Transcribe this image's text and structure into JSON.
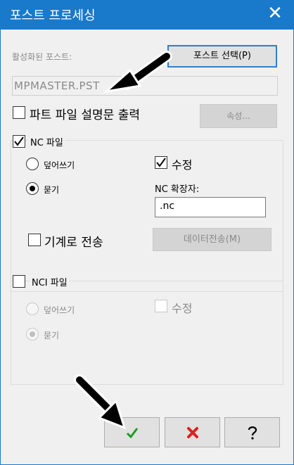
{
  "window": {
    "title": "포스트 프로세싱",
    "close_label": "✕"
  },
  "post": {
    "active_label": "활성화된 포스트:",
    "select_button": "포스트 선택(P)",
    "path_value": "MPMASTER.PST",
    "print_desc_label": "파트 파일 설명문 출력",
    "properties_button": "속성..."
  },
  "nc": {
    "group_title": "NC 파일",
    "overwrite_label": "덮어쓰기",
    "ask_label": "묻기",
    "edit_label": "수정",
    "ext_label": "NC 확장자:",
    "ext_value": ".nc",
    "send_label": "기계로 전송",
    "transfer_button": "데이터전송(M)"
  },
  "nci": {
    "group_title": "NCI 파일",
    "overwrite_label": "덮어쓰기",
    "ask_label": "묻기",
    "edit_label": "수정"
  },
  "footer": {
    "ok_icon": "checkmark-icon",
    "cancel_icon": "red-x-icon",
    "help_icon": "question-icon"
  },
  "colors": {
    "titlebar": "#1979ca",
    "ok": "#1a9d1a",
    "cancel": "#e0201c"
  }
}
